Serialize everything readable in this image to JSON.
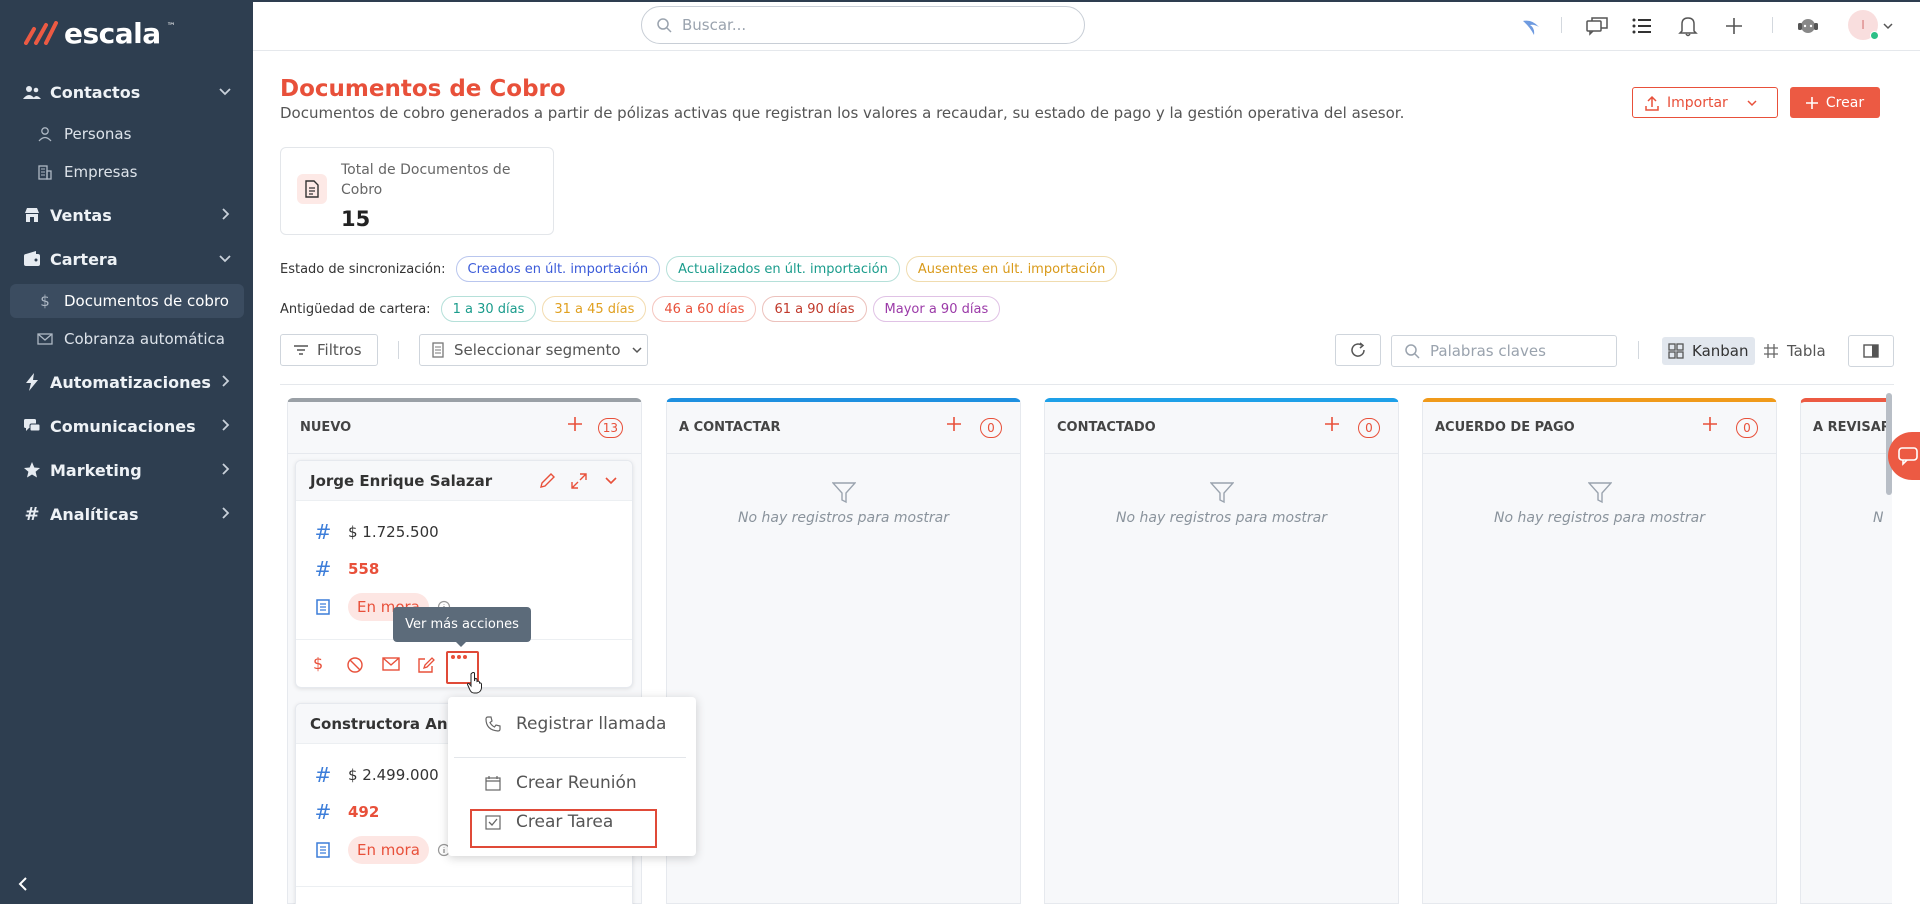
{
  "brand": {
    "name": "escala",
    "tm": "™"
  },
  "sidebar": {
    "sections": [
      {
        "label": "Contactos",
        "icon": "users-icon",
        "expanded": true
      },
      {
        "label": "Ventas",
        "icon": "store-icon",
        "expanded": false
      },
      {
        "label": "Cartera",
        "icon": "wallet-icon",
        "expanded": true
      },
      {
        "label": "Automatizaciones",
        "icon": "bolt-icon",
        "expanded": false
      },
      {
        "label": "Comunicaciones",
        "icon": "chat-icon",
        "expanded": false
      },
      {
        "label": "Marketing",
        "icon": "star-icon",
        "expanded": false
      },
      {
        "label": "Analíticas",
        "icon": "hash-icon",
        "expanded": false
      }
    ],
    "subitems": [
      {
        "label": "Personas",
        "icon": "person-icon"
      },
      {
        "label": "Empresas",
        "icon": "building-icon"
      },
      {
        "label": "Documentos de cobro",
        "icon": "dollar-icon",
        "active": true
      },
      {
        "label": "Cobranza automática",
        "icon": "mail-icon"
      }
    ]
  },
  "topbar": {
    "search_placeholder": "Buscar...",
    "avatar_initial": "I"
  },
  "page": {
    "title": "Documentos de Cobro",
    "description": "Documentos de cobro generados a partir de pólizas activas que registran los valores a recaudar, su estado de pago y la gestión operativa del asesor.",
    "import_label": "Importar",
    "create_label": "Crear"
  },
  "stat": {
    "label": "Total de Documentos de Cobro",
    "value": "15"
  },
  "sync": {
    "label": "Estado de sincronización:",
    "chips": [
      {
        "label": "Creados en últ. importación",
        "color": "#3b5bd9"
      },
      {
        "label": "Actualizados en últ. importación",
        "color": "#1a9c8c"
      },
      {
        "label": "Ausentes en últ. importación",
        "color": "#d99a1a"
      }
    ]
  },
  "aging": {
    "label": "Antigüedad de cartera:",
    "chips": [
      {
        "label": "1 a 30 días",
        "color": "#1a9c8c"
      },
      {
        "label": "31 a 45 días",
        "color": "#e0a020"
      },
      {
        "label": "46 a 60 días",
        "color": "#e8503a"
      },
      {
        "label": "61 a 90 días",
        "color": "#c0392b"
      },
      {
        "label": "Mayor a 90 días",
        "color": "#9b3aa8"
      }
    ]
  },
  "toolbar": {
    "filters_label": "Filtros",
    "segment_label": "Seleccionar segmento",
    "keywords_placeholder": "Palabras claves",
    "kanban_label": "Kanban",
    "table_label": "Tabla"
  },
  "columns": [
    {
      "name": "NUEVO",
      "count": "13",
      "color": "#9aa0a6"
    },
    {
      "name": "A CONTACTAR",
      "count": "0",
      "color": "#1e90e0"
    },
    {
      "name": "CONTACTADO",
      "count": "0",
      "color": "#1ea0e8"
    },
    {
      "name": "ACUERDO DE PAGO",
      "count": "0",
      "color": "#f09a1a"
    },
    {
      "name": "A REVISAR",
      "count": "",
      "color": "#ec5a43"
    }
  ],
  "empty_text": "No hay registros para mostrar",
  "empty_text_partial": "N",
  "cards": [
    {
      "name": "Jorge Enrique Salazar",
      "amount": "$ 1.725.500",
      "number": "558",
      "status": "En mora"
    },
    {
      "name": "Constructora Andin",
      "amount": "$ 2.499.000",
      "number": "492",
      "status": "En mora"
    }
  ],
  "tooltip": "Ver más acciones",
  "menu": {
    "items": [
      {
        "label": "Registrar llamada",
        "icon": "phone-icon"
      },
      {
        "label": "Crear Reunión",
        "icon": "calendar-icon"
      },
      {
        "label": "Crear Tarea",
        "icon": "task-icon"
      }
    ]
  },
  "colors": {
    "accent": "#e8503a",
    "sidebar": "#2e3e50"
  }
}
